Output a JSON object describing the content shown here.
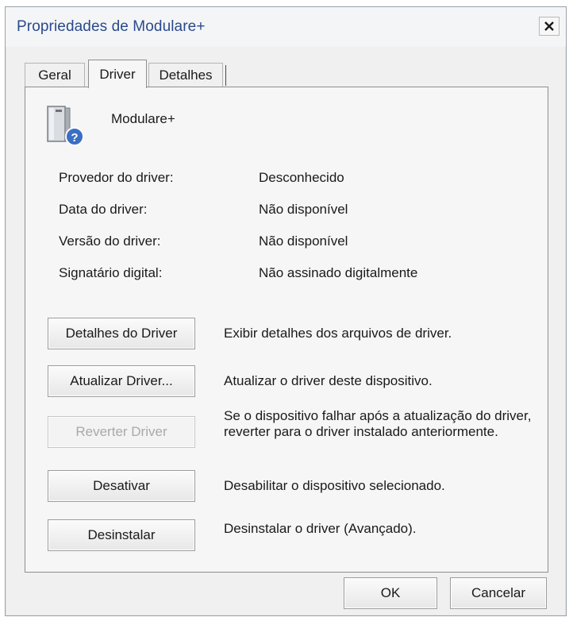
{
  "window": {
    "title": "Propriedades de Modulare+",
    "close_icon": "close-icon"
  },
  "tabs": [
    {
      "label": "Geral",
      "active": false
    },
    {
      "label": "Driver",
      "active": true
    },
    {
      "label": "Detalhes",
      "active": false
    }
  ],
  "device": {
    "name": "Modulare+",
    "icon": "unknown-device-icon"
  },
  "info": [
    {
      "label": "Provedor do driver:",
      "value": "Desconhecido"
    },
    {
      "label": "Data do driver:",
      "value": "Não disponível"
    },
    {
      "label": "Versão do driver:",
      "value": "Não disponível"
    },
    {
      "label": "Signatário digital:",
      "value": "Não assinado digitalmente"
    }
  ],
  "actions": [
    {
      "label": "Detalhes do Driver",
      "description": "Exibir detalhes dos arquivos de driver.",
      "enabled": true
    },
    {
      "label": "Atualizar Driver...",
      "description": "Atualizar o driver deste dispositivo.",
      "enabled": true
    },
    {
      "label": "Reverter Driver",
      "description": "Se o dispositivo falhar após a atualização do driver, reverter para o driver instalado anteriormente.",
      "enabled": false
    },
    {
      "label": "Desativar",
      "description": "Desabilitar o dispositivo selecionado.",
      "enabled": true
    },
    {
      "label": "Desinstalar",
      "description": "Desinstalar o driver (Avançado).",
      "enabled": true
    }
  ],
  "footer": {
    "ok_label": "OK",
    "cancel_label": "Cancelar"
  },
  "colors": {
    "title_text": "#2a4a8a",
    "dialog_bg": "#f0f0f0",
    "disabled_text": "#a9a9a9"
  }
}
